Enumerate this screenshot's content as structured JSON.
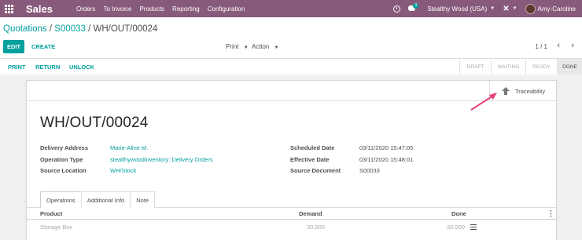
{
  "navbar": {
    "app_name": "Sales",
    "menu": [
      "Orders",
      "To Invoice",
      "Products",
      "Reporting",
      "Configuration"
    ],
    "chat_count": "3",
    "company": "Stealthy Wood (USA)",
    "user": "Amy-Caroline"
  },
  "breadcrumb": {
    "root": "Quotations",
    "sep1": "/",
    "parent": "S00033",
    "sep2": "/",
    "current": "WH/OUT/00024"
  },
  "toolbar": {
    "edit": "EDIT",
    "create": "CREATE",
    "print": "Print",
    "action": "Action",
    "pager": "1 / 1"
  },
  "actions": {
    "print": "PRINT",
    "return": "RETURN",
    "unlock": "UNLOCK"
  },
  "stages": [
    "DRAFT",
    "WAITING",
    "READY",
    "DONE"
  ],
  "active_stage": "DONE",
  "button_box": {
    "traceability": "Traceability"
  },
  "record": {
    "title": "WH/OUT/00024",
    "left_fields": [
      {
        "label": "Delivery Address",
        "value": "Marie-Aline M."
      },
      {
        "label": "Operation Type",
        "value": "stealthywoodinventory: Delivery Orders"
      },
      {
        "label": "Source Location",
        "value": "WH/Stock"
      }
    ],
    "right_fields": [
      {
        "label": "Scheduled Date",
        "value": "03/11/2020 15:47:05"
      },
      {
        "label": "Effective Date",
        "value": "03/11/2020 15:48:01"
      },
      {
        "label": "Source Document",
        "value": "S00033"
      }
    ]
  },
  "tabs": [
    "Operations",
    "Additional Info",
    "Note"
  ],
  "table": {
    "headers": [
      "Product",
      "Demand",
      "Done"
    ],
    "rows": [
      {
        "product": "Storage Box",
        "demand": "30.000",
        "done": "30.000"
      }
    ]
  },
  "colors": {
    "navbar": "#875a7b",
    "accent": "#00a09d",
    "annotation_arrow": "#e8407a"
  }
}
